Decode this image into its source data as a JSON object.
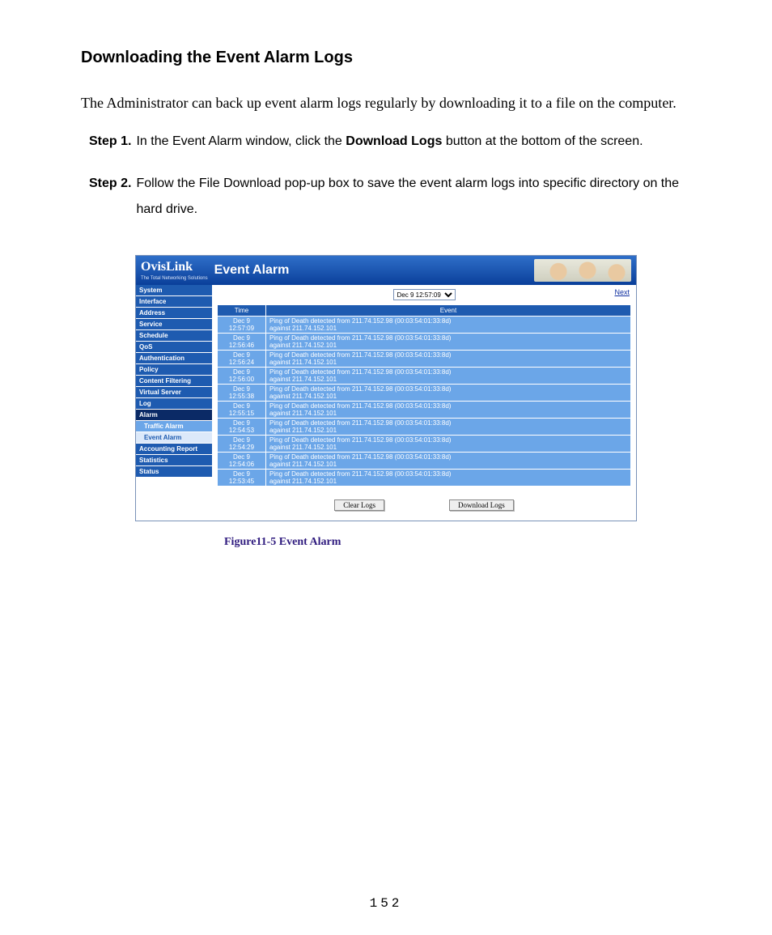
{
  "doc": {
    "heading": "Downloading the Event Alarm Logs",
    "intro": "The Administrator can back up event alarm logs regularly by downloading it to a file on the computer.",
    "step1_label": "Step 1.",
    "step1_a": "In the Event Alarm window, click the ",
    "step1_bold": "Download Logs",
    "step1_b": " button at the bottom of the screen.",
    "step2_label": "Step 2.",
    "step2": "Follow the File Download pop-up box to save the event alarm logs into specific directory on the hard drive.",
    "caption": "Figure11-5    Event Alarm",
    "page_number": "152"
  },
  "app": {
    "brand": "OvisLink",
    "brand_sub": "The Total Networking Solutions",
    "title": "Event Alarm",
    "selector_value": "Dec 9 12:57:09",
    "next_label": "Next",
    "th_time": "Time",
    "th_event": "Event",
    "clear_btn": "Clear Logs",
    "download_btn": "Download Logs",
    "nav": {
      "system": "System",
      "interface": "Interface",
      "address": "Address",
      "service": "Service",
      "schedule": "Schedule",
      "qos": "QoS",
      "authentication": "Authentication",
      "policy": "Policy",
      "content_filtering": "Content Filtering",
      "virtual_server": "Virtual Server",
      "log": "Log",
      "alarm": "Alarm",
      "traffic_alarm": "Traffic Alarm",
      "event_alarm": "Event Alarm",
      "accounting_report": "Accounting Report",
      "statistics": "Statistics",
      "status": "Status"
    },
    "rows": [
      {
        "t1": "Dec 9",
        "t2": "12:57:09",
        "e1": "Ping of Death detected from 211.74.152.98 (00:03:54:01:33:8d)",
        "e2": "against 211.74.152.101"
      },
      {
        "t1": "Dec 9",
        "t2": "12:56:46",
        "e1": "Ping of Death detected from 211.74.152.98 (00:03:54:01:33:8d)",
        "e2": "against 211.74.152.101"
      },
      {
        "t1": "Dec 9",
        "t2": "12:56:24",
        "e1": "Ping of Death detected from 211.74.152.98 (00:03:54:01:33:8d)",
        "e2": "against 211.74.152.101"
      },
      {
        "t1": "Dec 9",
        "t2": "12:56:00",
        "e1": "Ping of Death detected from 211.74.152.98 (00:03:54:01:33:8d)",
        "e2": "against 211.74.152.101"
      },
      {
        "t1": "Dec 9",
        "t2": "12:55:38",
        "e1": "Ping of Death detected from 211.74.152.98 (00:03:54:01:33:8d)",
        "e2": "against 211.74.152.101"
      },
      {
        "t1": "Dec 9",
        "t2": "12:55:15",
        "e1": "Ping of Death detected from 211.74.152.98 (00:03:54:01:33:8d)",
        "e2": "against 211.74.152.101"
      },
      {
        "t1": "Dec 9",
        "t2": "12:54:53",
        "e1": "Ping of Death detected from 211.74.152.98 (00:03:54:01:33:8d)",
        "e2": "against 211.74.152.101"
      },
      {
        "t1": "Dec 9",
        "t2": "12:54:29",
        "e1": "Ping of Death detected from 211.74.152.98 (00:03:54:01:33:8d)",
        "e2": "against 211.74.152.101"
      },
      {
        "t1": "Dec 9",
        "t2": "12:54:06",
        "e1": "Ping of Death detected from 211.74.152.98 (00:03:54:01:33:8d)",
        "e2": "against 211.74.152.101"
      },
      {
        "t1": "Dec 9",
        "t2": "12:53:45",
        "e1": "Ping of Death detected from 211.74.152.98 (00:03:54:01:33:8d)",
        "e2": "against 211.74.152.101"
      }
    ]
  }
}
